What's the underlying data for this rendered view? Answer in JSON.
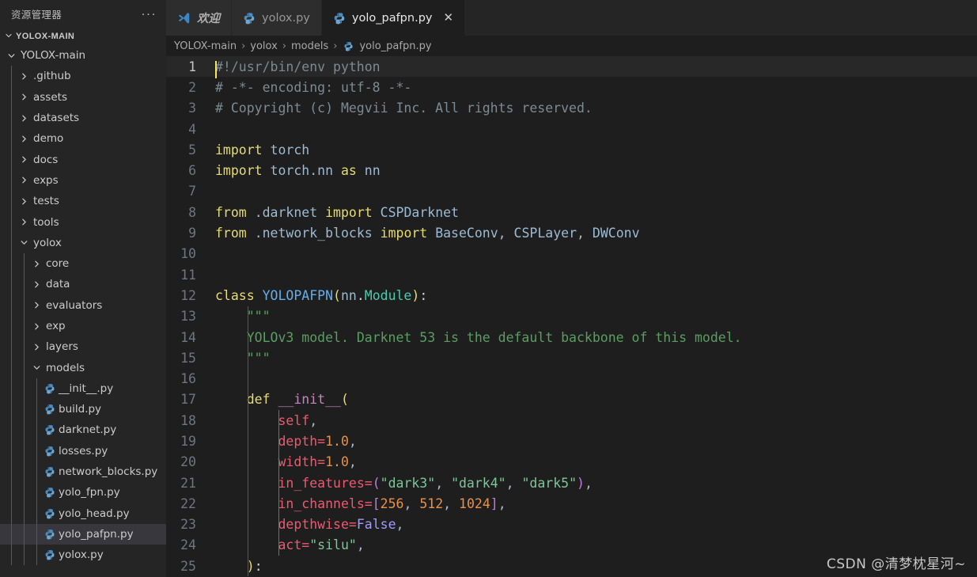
{
  "sidebar": {
    "title": "资源管理器",
    "more_actions": "···",
    "workspace": "YOLOX-MAIN",
    "tree": [
      {
        "label": "YOLOX-main",
        "depth": 0,
        "kind": "folder",
        "state": "expanded",
        "selected": false
      },
      {
        "label": ".github",
        "depth": 1,
        "kind": "folder",
        "state": "collapsed",
        "selected": false
      },
      {
        "label": "assets",
        "depth": 1,
        "kind": "folder",
        "state": "collapsed",
        "selected": false
      },
      {
        "label": "datasets",
        "depth": 1,
        "kind": "folder",
        "state": "collapsed",
        "selected": false
      },
      {
        "label": "demo",
        "depth": 1,
        "kind": "folder",
        "state": "collapsed",
        "selected": false
      },
      {
        "label": "docs",
        "depth": 1,
        "kind": "folder",
        "state": "collapsed",
        "selected": false
      },
      {
        "label": "exps",
        "depth": 1,
        "kind": "folder",
        "state": "collapsed",
        "selected": false
      },
      {
        "label": "tests",
        "depth": 1,
        "kind": "folder",
        "state": "collapsed",
        "selected": false
      },
      {
        "label": "tools",
        "depth": 1,
        "kind": "folder",
        "state": "collapsed",
        "selected": false
      },
      {
        "label": "yolox",
        "depth": 1,
        "kind": "folder",
        "state": "expanded",
        "selected": false
      },
      {
        "label": "core",
        "depth": 2,
        "kind": "folder",
        "state": "collapsed",
        "selected": false
      },
      {
        "label": "data",
        "depth": 2,
        "kind": "folder",
        "state": "collapsed",
        "selected": false
      },
      {
        "label": "evaluators",
        "depth": 2,
        "kind": "folder",
        "state": "collapsed",
        "selected": false
      },
      {
        "label": "exp",
        "depth": 2,
        "kind": "folder",
        "state": "collapsed",
        "selected": false
      },
      {
        "label": "layers",
        "depth": 2,
        "kind": "folder",
        "state": "collapsed",
        "selected": false
      },
      {
        "label": "models",
        "depth": 2,
        "kind": "folder",
        "state": "expanded",
        "selected": false
      },
      {
        "label": "__init__.py",
        "depth": 3,
        "kind": "python",
        "state": "",
        "selected": false
      },
      {
        "label": "build.py",
        "depth": 3,
        "kind": "python",
        "state": "",
        "selected": false
      },
      {
        "label": "darknet.py",
        "depth": 3,
        "kind": "python",
        "state": "",
        "selected": false
      },
      {
        "label": "losses.py",
        "depth": 3,
        "kind": "python",
        "state": "",
        "selected": false
      },
      {
        "label": "network_blocks.py",
        "depth": 3,
        "kind": "python",
        "state": "",
        "selected": false
      },
      {
        "label": "yolo_fpn.py",
        "depth": 3,
        "kind": "python",
        "state": "",
        "selected": false
      },
      {
        "label": "yolo_head.py",
        "depth": 3,
        "kind": "python",
        "state": "",
        "selected": false
      },
      {
        "label": "yolo_pafpn.py",
        "depth": 3,
        "kind": "python",
        "state": "",
        "selected": true
      },
      {
        "label": "yolox.py",
        "depth": 3,
        "kind": "python",
        "state": "",
        "selected": false
      }
    ]
  },
  "tabs": [
    {
      "label": "欢迎",
      "icon": "vscode-icon",
      "active": false,
      "closable": false,
      "italic": true
    },
    {
      "label": "yolox.py",
      "icon": "python-icon",
      "active": false,
      "closable": false,
      "italic": false
    },
    {
      "label": "yolo_pafpn.py",
      "icon": "python-icon",
      "active": true,
      "closable": true,
      "italic": false
    }
  ],
  "tab_close_glyph": "✕",
  "breadcrumb": {
    "items": [
      "YOLOX-main",
      "yolox",
      "models",
      "yolo_pafpn.py"
    ],
    "separator": "›",
    "file_icon": "python-icon"
  },
  "editor": {
    "language": "python",
    "current_line": 1,
    "first_visible_line": 1,
    "last_visible_line": 25,
    "line_numbers": [
      1,
      2,
      3,
      4,
      5,
      6,
      7,
      8,
      9,
      10,
      11,
      12,
      13,
      14,
      15,
      16,
      17,
      18,
      19,
      20,
      21,
      22,
      23,
      24,
      25
    ],
    "lines": [
      "#!/usr/bin/env python",
      "# -*- encoding: utf-8 -*-",
      "# Copyright (c) Megvii Inc. All rights reserved.",
      "",
      "import torch",
      "import torch.nn as nn",
      "",
      "from .darknet import CSPDarknet",
      "from .network_blocks import BaseConv, CSPLayer, DWConv",
      "",
      "",
      "class YOLOPAFPN(nn.Module):",
      "    \"\"\"",
      "    YOLOv3 model. Darknet 53 is the default backbone of this model.",
      "    \"\"\"",
      "",
      "    def __init__(",
      "        self,",
      "        depth=1.0,",
      "        width=1.0,",
      "        in_features=(\"dark3\", \"dark4\", \"dark5\"),",
      "        in_channels=[256, 512, 1024],",
      "        depthwise=False,",
      "        act=\"silu\",",
      "    ):"
    ]
  },
  "watermark": "CSDN @清梦枕星河~",
  "colors": {
    "editor_bg": "#1e1e1e",
    "sidebar_bg": "#252526",
    "tab_inactive_bg": "#2d2d2d",
    "tab_active_bg": "#1e1e1e",
    "selection_bg": "#37373d",
    "current_line_bg": "#282828",
    "line_number": "#6e7681",
    "keyword": "#e6db74",
    "string": "#7ec699",
    "comment": "#7c8a93",
    "docstring": "#5a9e62",
    "number": "#e8914b",
    "parameter": "#ef596f",
    "class_name": "#61afef",
    "function_name": "#c586c0",
    "cursor": "#f5e663",
    "python_icon": "#4b8bbe"
  }
}
